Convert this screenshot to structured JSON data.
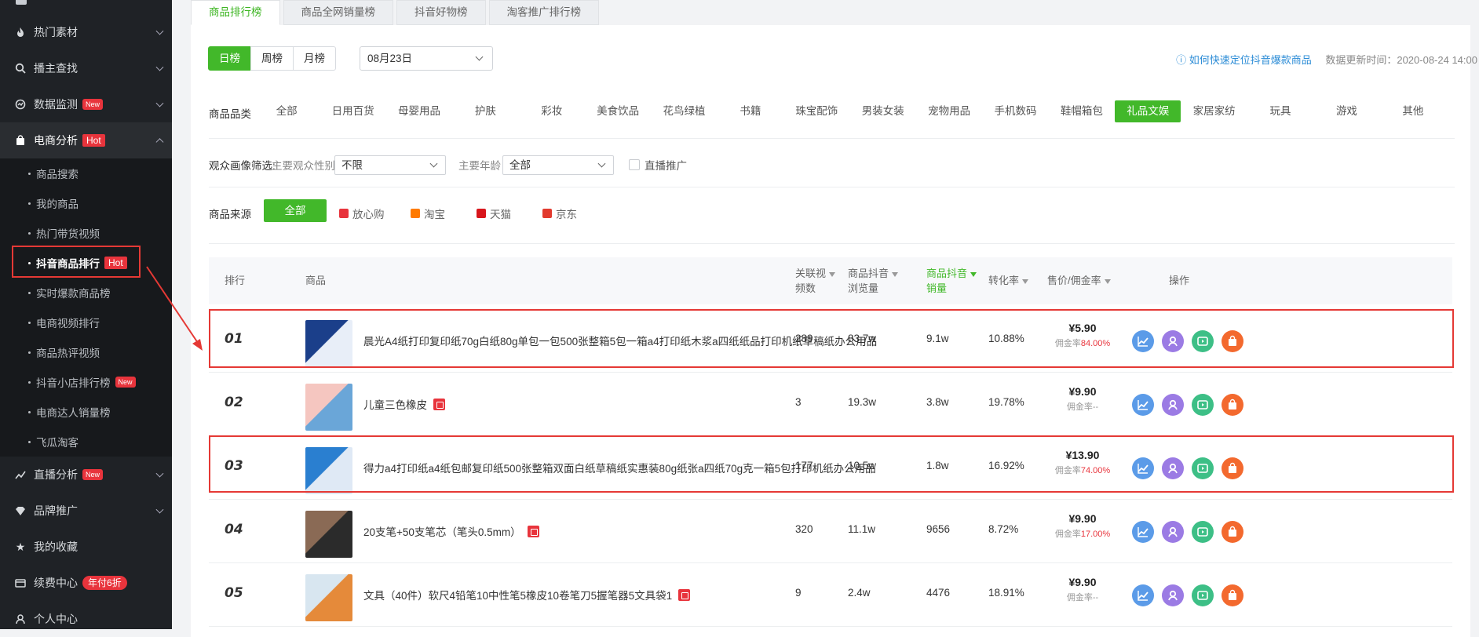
{
  "sidebar": {
    "items": [
      {
        "label": "热门素材",
        "icon": "fire-icon"
      },
      {
        "label": "播主查找",
        "icon": "search-icon"
      },
      {
        "label": "数据监测",
        "icon": "monitor-icon",
        "badge": "New"
      },
      {
        "label": "电商分析",
        "icon": "shopping-bag-icon",
        "badge": "Hot"
      }
    ],
    "sub_items": [
      {
        "label": "商品搜索"
      },
      {
        "label": "我的商品"
      },
      {
        "label": "热门带货视频"
      },
      {
        "label": "抖音商品排行",
        "badge": "Hot"
      },
      {
        "label": "实时爆款商品榜"
      },
      {
        "label": "电商视频排行"
      },
      {
        "label": "商品热评视频"
      },
      {
        "label": "抖音小店排行榜",
        "badge": "New"
      },
      {
        "label": "电商达人销量榜"
      },
      {
        "label": "飞瓜淘客"
      }
    ],
    "bottom_items": [
      {
        "label": "直播分析",
        "icon": "live-chart-icon",
        "badge": "New"
      },
      {
        "label": "品牌推广",
        "icon": "diamond-icon"
      },
      {
        "label": "我的收藏",
        "icon": "star-icon"
      },
      {
        "label": "续费中心",
        "icon": "card-icon",
        "badge": "年付6折"
      },
      {
        "label": "个人中心",
        "icon": "user-icon"
      }
    ]
  },
  "tabs": [
    {
      "label": "商品排行榜"
    },
    {
      "label": "商品全网销量榜"
    },
    {
      "label": "抖音好物榜"
    },
    {
      "label": "淘客推广排行榜"
    }
  ],
  "filters": {
    "period": [
      "日榜",
      "周榜",
      "月榜"
    ],
    "date": "08月23日",
    "help_link": "如何快速定位抖音爆款商品",
    "update_time": "数据更新时间：2020-08-24 14:00",
    "category_label": "商品品类",
    "categories": [
      "全部",
      "日用百货",
      "母婴用品",
      "护肤",
      "彩妆",
      "美食饮品",
      "花鸟绿植",
      "书籍",
      "珠宝配饰",
      "男装女装",
      "宠物用品",
      "手机数码",
      "鞋帽箱包",
      "礼品文娱",
      "家居家纺",
      "玩具",
      "游戏",
      "其他"
    ],
    "category_selected": "礼品文娱",
    "audience_label": "观众画像筛选:",
    "gender_label": "主要观众性别",
    "gender_value": "不限",
    "age_label": "主要年龄",
    "age_value": "全部",
    "live_promo": "直播推广",
    "source_label": "商品来源",
    "source_all": "全部",
    "sources": [
      {
        "label": "放心购",
        "color": "#e8343c"
      },
      {
        "label": "淘宝",
        "color": "#ff7a00"
      },
      {
        "label": "天猫",
        "color": "#d8161c"
      },
      {
        "label": "京东",
        "color": "#e23a2e"
      }
    ]
  },
  "table": {
    "headers": {
      "rank": "排行",
      "product": "商品",
      "videos_1": "关联视",
      "videos_2": "频数",
      "views_1": "商品抖音",
      "views_2": "浏览量",
      "sales_1": "商品抖音",
      "sales_2": "销量",
      "conversion": "转化率",
      "price": "售价/佣金率",
      "actions": "操作"
    },
    "rows": [
      {
        "rank": "01",
        "name": "晨光A4纸打印复印纸70g白纸80g单包一包500张整箱5包一箱a4打印纸木浆a四纸纸品打印机纸草稿纸办公用品",
        "videos": "289",
        "views": "83.7w",
        "sales": "9.1w",
        "conversion": "10.88%",
        "price": "¥5.90",
        "commission_label": "佣金率",
        "commission": "84.00%",
        "tag": false
      },
      {
        "rank": "02",
        "name": "儿童三色橡皮",
        "videos": "3",
        "views": "19.3w",
        "sales": "3.8w",
        "conversion": "19.78%",
        "price": "¥9.90",
        "commission_label": "佣金率",
        "commission": "--",
        "tag": true
      },
      {
        "rank": "03",
        "name": "得力a4打印纸a4纸包邮复印纸500张整箱双面白纸草稿纸实惠装80g纸张a四纸70g克一箱5包打印机纸办公用品",
        "videos": "177",
        "views": "10.5w",
        "sales": "1.8w",
        "conversion": "16.92%",
        "price": "¥13.90",
        "commission_label": "佣金率",
        "commission": "74.00%",
        "tag": false
      },
      {
        "rank": "04",
        "name": "20支笔+50支笔芯（笔头0.5mm）",
        "videos": "320",
        "views": "11.1w",
        "sales": "9656",
        "conversion": "8.72%",
        "price": "¥9.90",
        "commission_label": "佣金率",
        "commission": "17.00%",
        "tag": true
      },
      {
        "rank": "05",
        "name": "文具（40件）软尺4铅笔10中性笔5橡皮10卷笔刀5握笔器5文具袋1",
        "videos": "9",
        "views": "2.4w",
        "sales": "4476",
        "conversion": "18.91%",
        "price": "¥9.90",
        "commission_label": "佣金率",
        "commission": "--",
        "tag": true
      }
    ],
    "action_icons": [
      {
        "name": "trend-chart-icon",
        "color": "#5b9be8"
      },
      {
        "name": "profile-icon",
        "color": "#9b7be4"
      },
      {
        "name": "play-video-icon",
        "color": "#3dbf86"
      },
      {
        "name": "shop-icon",
        "color": "#f3692e"
      }
    ]
  },
  "colors": {
    "accent": "#42b82a",
    "sidebar_bg": "#1f2226",
    "annotation": "#e53935",
    "badge": "#e8343c"
  }
}
